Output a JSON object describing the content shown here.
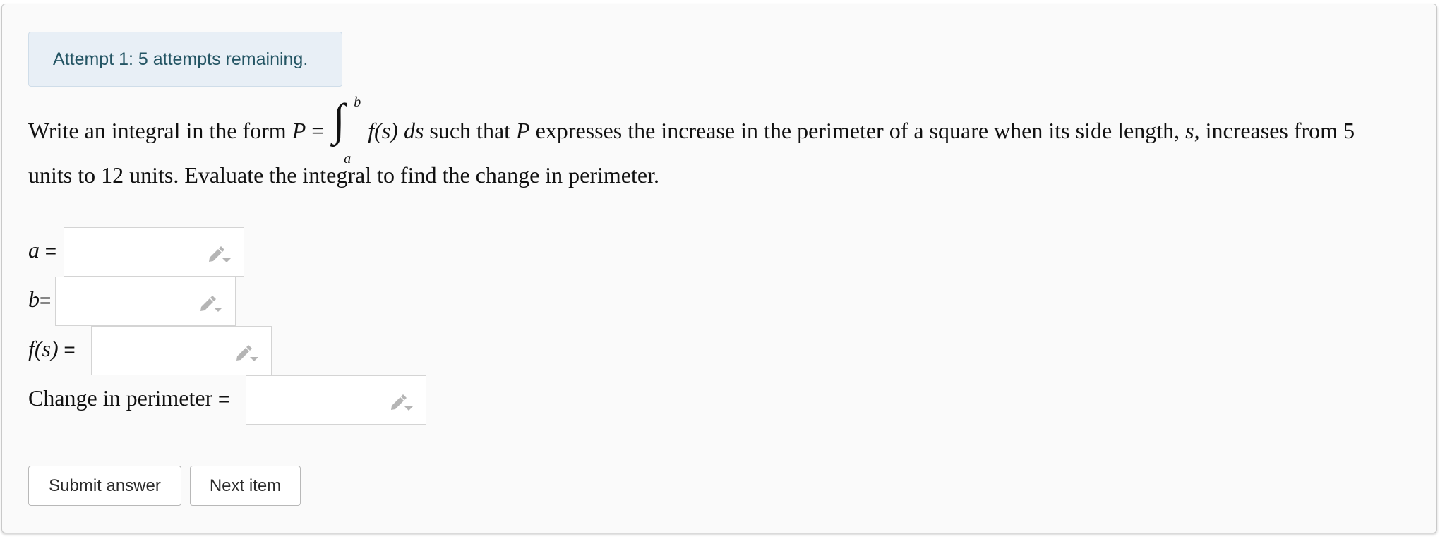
{
  "attempt_notice": "Attempt 1: 5 attempts remaining.",
  "prompt": {
    "text_before": "Write an integral in the form",
    "math_P": "P",
    "math_equals": "=",
    "integral_sign": "∫",
    "integral_upper": "b",
    "integral_lower": "a",
    "integrand": "f(s) ds",
    "text_mid1": "such that",
    "math_P2": "P",
    "text_mid2": "expresses the increase in the perimeter of a square when its side length,",
    "math_s": "s",
    "text_mid3": ", increases from 5",
    "line2": "units to 12 units. Evaluate the integral to find the change in perimeter."
  },
  "fields": [
    {
      "var": "a",
      "eq": " =",
      "value": ""
    },
    {
      "var": "b",
      "eq": "=",
      "value": ""
    },
    {
      "var": "f(s)",
      "eq": " =",
      "value": ""
    },
    {
      "var": "Change in perimeter",
      "eq": " =",
      "value": ""
    }
  ],
  "buttons": {
    "submit": "Submit answer",
    "next": "Next item"
  },
  "icons": {
    "field_icon": "pencil-dropdown-icon"
  },
  "colors": {
    "alert_bg": "#e8eff6",
    "alert_text": "#245564",
    "icon": "#b5b5b5"
  }
}
